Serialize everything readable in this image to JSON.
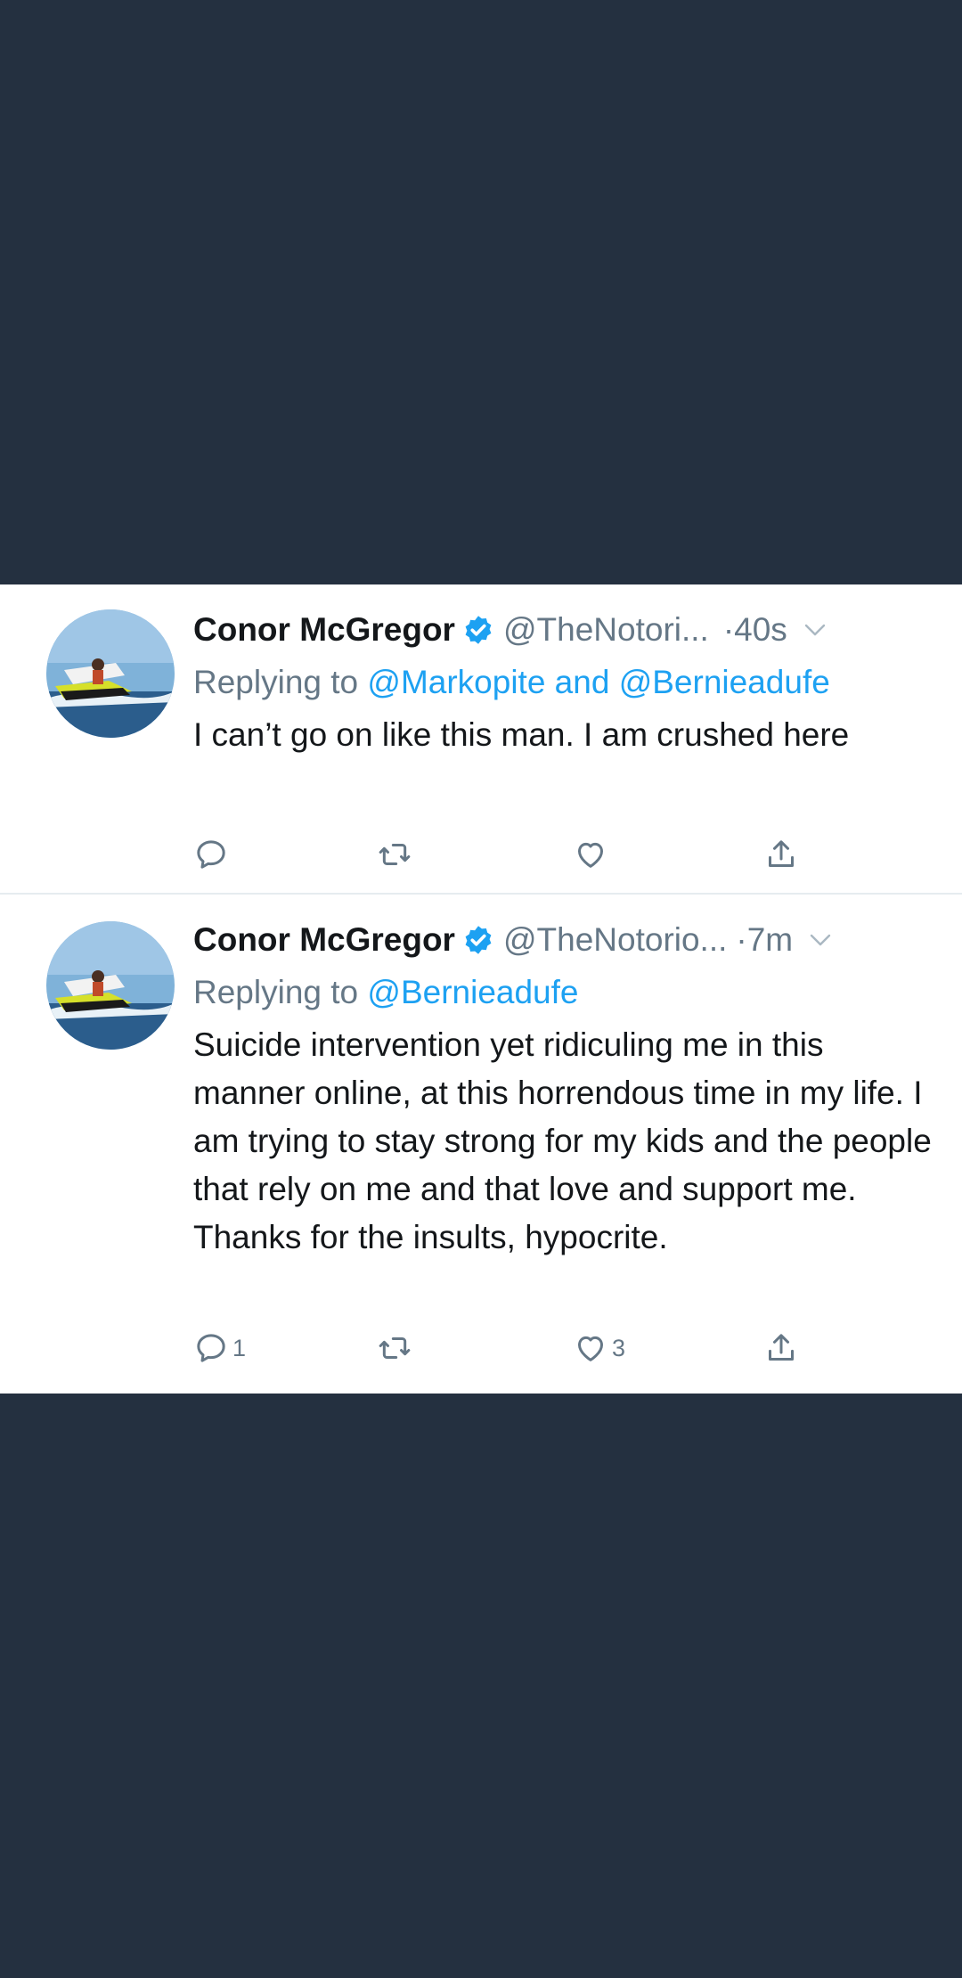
{
  "tweets": [
    {
      "name": "Conor McGregor",
      "handle": "@TheNotori...",
      "dot": "·",
      "time": "40s",
      "replying_prefix": "Replying to",
      "replying_targets": "@Markopite and @Bernieadufe",
      "text": "I can’t go on like this man. I am crushed here",
      "reply_count": "",
      "retweet_count": "",
      "like_count": ""
    },
    {
      "name": "Conor McGregor",
      "handle": "@TheNotorio...",
      "dot": "·",
      "time": "7m",
      "replying_prefix": "Replying to",
      "replying_targets": "@Bernieadufe",
      "text": "Suicide intervention yet ridiculing me in this manner online, at this horrendous time in my life. I am trying to stay strong for my kids and the people that rely on me and that love and support me. Thanks for the insults, hypocrite.",
      "reply_count": "1",
      "retweet_count": "",
      "like_count": "3"
    }
  ],
  "icons": {
    "verified": "verified-badge-icon",
    "caret": "chevron-down-icon",
    "reply": "reply-icon",
    "retweet": "retweet-icon",
    "like": "heart-icon",
    "share": "share-icon"
  },
  "colors": {
    "background_band": "#243040",
    "card": "#ffffff",
    "accent": "#1da1f2",
    "secondary_text": "#657786",
    "primary_text": "#14171a"
  }
}
